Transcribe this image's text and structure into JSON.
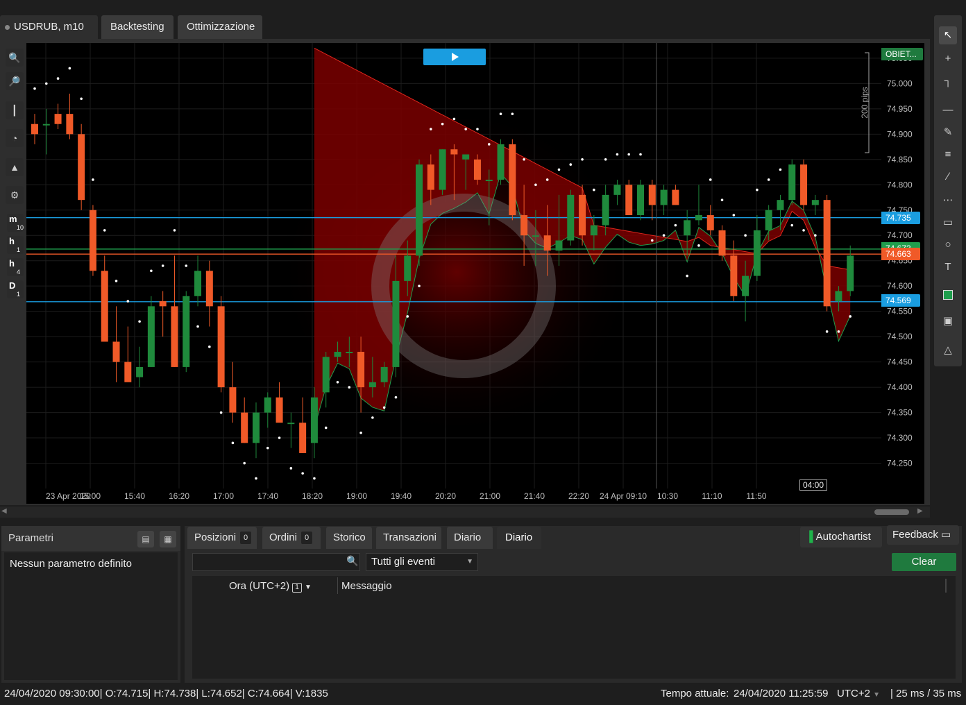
{
  "tabs": [
    {
      "label": "USDRUB, m10",
      "active": true
    },
    {
      "label": "Backtesting",
      "active": false
    },
    {
      "label": "Ottimizzazione",
      "active": false
    }
  ],
  "left_toolbar": {
    "timeframes": [
      {
        "label": "m",
        "sub": "10"
      },
      {
        "label": "h",
        "sub": "1"
      },
      {
        "label": "h",
        "sub": "4"
      },
      {
        "label": "D",
        "sub": "1"
      }
    ]
  },
  "chart_data": {
    "type": "candlestick",
    "symbol": "USDRUB",
    "timeframe": "m10",
    "ylim": [
      74.2,
      75.08
    ],
    "y_ticks": [
      "75.050",
      "75.000",
      "74.950",
      "74.900",
      "74.850",
      "74.800",
      "74.750",
      "74.700",
      "74.650",
      "74.600",
      "74.550",
      "74.500",
      "74.450",
      "74.400",
      "74.350",
      "74.300",
      "74.250"
    ],
    "x_ticks": [
      "23 Apr 2020",
      "15:00",
      "15:40",
      "16:20",
      "17:00",
      "17:40",
      "18:20",
      "19:00",
      "19:40",
      "20:20",
      "21:00",
      "21:40",
      "22:20",
      "24 Apr 09:10",
      "10:30",
      "11:10",
      "11:50"
    ],
    "candles": [
      [
        74.92,
        74.94,
        74.88,
        74.9
      ],
      [
        74.92,
        74.95,
        74.86,
        74.92
      ],
      [
        74.94,
        74.96,
        74.91,
        74.92
      ],
      [
        74.94,
        74.98,
        74.89,
        74.9
      ],
      [
        74.9,
        74.92,
        74.75,
        74.77
      ],
      [
        74.75,
        74.76,
        74.62,
        74.63
      ],
      [
        74.63,
        74.66,
        74.52,
        74.49
      ],
      [
        74.49,
        74.56,
        74.41,
        74.45
      ],
      [
        74.45,
        74.52,
        74.43,
        74.41
      ],
      [
        74.42,
        74.48,
        74.4,
        74.44
      ],
      [
        74.44,
        74.58,
        74.44,
        74.56
      ],
      [
        74.57,
        74.59,
        74.5,
        74.56
      ],
      [
        74.56,
        74.66,
        74.44,
        74.44
      ],
      [
        74.44,
        74.59,
        74.43,
        74.58
      ],
      [
        74.58,
        74.66,
        74.56,
        74.63
      ],
      [
        74.63,
        74.65,
        74.52,
        74.56
      ],
      [
        74.56,
        74.58,
        74.39,
        74.4
      ],
      [
        74.4,
        74.45,
        74.33,
        74.35
      ],
      [
        74.35,
        74.38,
        74.29,
        74.29
      ],
      [
        74.29,
        74.37,
        74.26,
        74.35
      ],
      [
        74.35,
        74.39,
        74.32,
        74.38
      ],
      [
        74.38,
        74.41,
        74.34,
        74.33
      ],
      [
        74.33,
        74.35,
        74.28,
        74.33
      ],
      [
        74.33,
        74.38,
        74.27,
        74.27
      ],
      [
        74.29,
        74.4,
        74.26,
        74.38
      ],
      [
        74.39,
        74.47,
        74.36,
        74.46
      ],
      [
        74.46,
        74.49,
        74.45,
        74.47
      ],
      [
        74.47,
        74.5,
        74.44,
        74.47
      ],
      [
        74.47,
        74.5,
        74.35,
        74.4
      ],
      [
        74.4,
        74.46,
        74.38,
        74.41
      ],
      [
        74.41,
        74.45,
        74.4,
        74.44
      ],
      [
        74.44,
        74.66,
        74.42,
        74.61
      ],
      [
        74.61,
        74.69,
        74.58,
        74.66
      ],
      [
        74.66,
        74.85,
        74.64,
        74.84
      ],
      [
        74.84,
        74.86,
        74.76,
        74.79
      ],
      [
        74.79,
        74.87,
        74.78,
        74.87
      ],
      [
        74.87,
        74.88,
        74.77,
        74.86
      ],
      [
        74.85,
        74.86,
        74.79,
        74.86
      ],
      [
        74.85,
        74.86,
        74.8,
        74.81
      ],
      [
        74.81,
        74.83,
        74.72,
        74.81
      ],
      [
        74.81,
        74.89,
        74.8,
        74.88
      ],
      [
        74.88,
        74.89,
        74.73,
        74.74
      ],
      [
        74.74,
        74.8,
        74.64,
        74.7
      ],
      [
        74.7,
        74.75,
        74.64,
        74.7
      ],
      [
        74.7,
        74.76,
        74.62,
        74.67
      ],
      [
        74.67,
        74.78,
        74.64,
        74.69
      ],
      [
        74.69,
        74.79,
        74.68,
        74.78
      ],
      [
        74.78,
        74.8,
        74.68,
        74.7
      ],
      [
        74.7,
        74.74,
        74.67,
        74.72
      ],
      [
        74.72,
        74.8,
        74.7,
        74.78
      ],
      [
        74.78,
        74.81,
        74.76,
        74.8
      ],
      [
        74.8,
        74.81,
        74.74,
        74.74
      ],
      [
        74.74,
        74.81,
        74.73,
        74.8
      ],
      [
        74.8,
        74.81,
        74.73,
        74.76
      ],
      [
        74.76,
        74.8,
        74.74,
        74.79
      ],
      [
        74.79,
        74.8,
        74.76,
        74.76
      ],
      [
        74.7,
        74.75,
        74.66,
        74.73
      ],
      [
        74.73,
        74.8,
        74.72,
        74.74
      ],
      [
        74.74,
        74.76,
        74.7,
        74.71
      ],
      [
        74.71,
        74.72,
        74.65,
        74.66
      ],
      [
        74.66,
        74.69,
        74.57,
        74.58
      ],
      [
        74.58,
        74.65,
        74.53,
        74.62
      ],
      [
        74.62,
        74.74,
        74.61,
        74.71
      ],
      [
        74.71,
        74.76,
        74.69,
        74.75
      ],
      [
        74.75,
        74.78,
        74.71,
        74.77
      ],
      [
        74.77,
        74.85,
        74.76,
        74.84
      ],
      [
        74.84,
        74.85,
        74.75,
        74.76
      ],
      [
        74.76,
        74.78,
        74.74,
        74.77
      ],
      [
        74.77,
        74.78,
        74.55,
        74.56
      ],
      [
        74.57,
        74.6,
        74.55,
        74.59
      ],
      [
        74.59,
        74.68,
        74.58,
        74.66
      ]
    ],
    "price_lines": [
      {
        "value": "74.735",
        "color": "#1a9de0"
      },
      {
        "value": "74.569",
        "color": "#1a9de0"
      },
      {
        "value": "74.673",
        "color": "#1f9e4d"
      },
      {
        "value": "74.663",
        "color": "#f05a28"
      }
    ],
    "objective_label": "OBIET...",
    "range_label": "200 pips",
    "countdown": "04:00"
  },
  "right_toolbar": {
    "icons": [
      "cursor-icon",
      "crosshair-icon",
      "measure-icon",
      "hline-icon",
      "pencil-icon",
      "fibonacci-icon",
      "channel-icon",
      "fib-fan-icon",
      "rectangle-icon",
      "circle-icon",
      "text-icon",
      "color-swatch-icon",
      "camera-icon",
      "alert-bell-icon"
    ]
  },
  "params": {
    "title": "Parametri",
    "empty_text": "Nessun parametro definito"
  },
  "bottom_tabs": [
    {
      "label": "Posizioni",
      "count": "0"
    },
    {
      "label": "Ordini",
      "count": "0"
    },
    {
      "label": "Storico"
    },
    {
      "label": "Transazioni"
    },
    {
      "label": "Diario"
    },
    {
      "label": "Diario",
      "active": true
    }
  ],
  "autochartist_label": "Autochartist",
  "feedback_label": "Feedback",
  "search": {
    "placeholder": ""
  },
  "filter": {
    "value": "Tutti gli eventi"
  },
  "clear_label": "Clear",
  "table": {
    "columns": [
      "Ora (UTC+2)",
      "Messaggio"
    ],
    "sort_badge": "1"
  },
  "status": {
    "ohlc": "24/04/2020 09:30:00| O:74.715| H:74.738| L:74.652| C:74.664| V:1835",
    "time_label": "Tempo attuale:",
    "time_value": "24/04/2020 11:25:59",
    "timezone": "UTC+2",
    "latency": "| 25 ms / 35 ms"
  },
  "colors": {
    "bull": "#1f8a3c",
    "bear": "#f05a28",
    "accent": "#1a9de0",
    "cloud": "#8b0000"
  }
}
